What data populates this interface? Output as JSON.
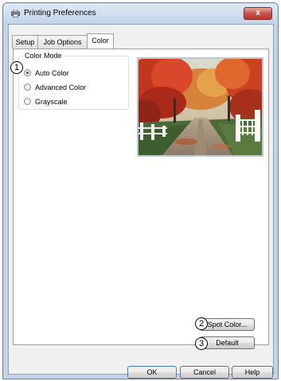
{
  "window": {
    "title": "Printing Preferences",
    "close_label": "x"
  },
  "tabs": [
    {
      "label": "Setup",
      "active": false
    },
    {
      "label": "Job Options",
      "active": false
    },
    {
      "label": "Color",
      "active": true
    }
  ],
  "color_mode": {
    "group_label": "Color Mode",
    "options": [
      {
        "label": "Auto Color",
        "checked": true
      },
      {
        "label": "Advanced Color",
        "checked": false
      },
      {
        "label": "Grayscale",
        "checked": false
      }
    ]
  },
  "buttons": {
    "spot_color": "Spot Color...",
    "default": "Default",
    "ok": "OK",
    "cancel": "Cancel",
    "help": "Help"
  },
  "callouts": [
    "1",
    "2",
    "3"
  ]
}
